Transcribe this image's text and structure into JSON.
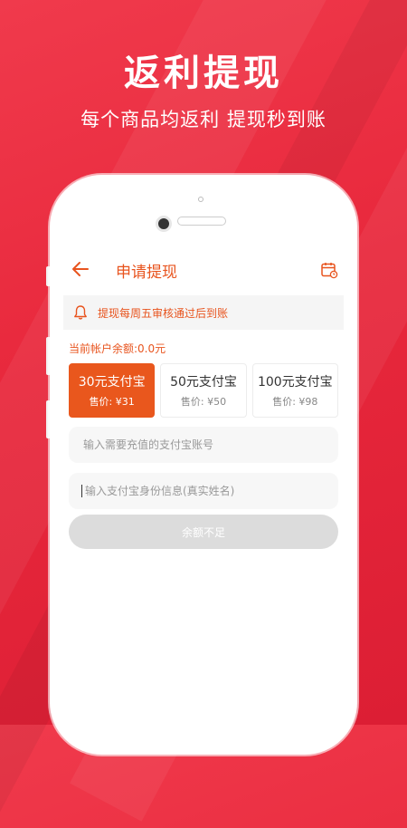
{
  "hero": {
    "title": "返利提现",
    "subtitle": "每个商品均返利  提现秒到账"
  },
  "app": {
    "nav_title": "申请提现",
    "notice": "提现每周五审核通过后到账",
    "balance": "当前帐户余额:0.0元",
    "options": [
      {
        "label": "30元支付宝",
        "price": "售价: ¥31",
        "selected": true
      },
      {
        "label": "50元支付宝",
        "price": "售价: ¥50",
        "selected": false
      },
      {
        "label": "100元支付宝",
        "price": "售价: ¥98",
        "selected": false
      }
    ],
    "account_placeholder": "输入需要充值的支付宝账号",
    "name_placeholder": "输入支付宝身份信息(真实姓名)",
    "submit_label": "余额不足"
  },
  "colors": {
    "accent": "#e9571d",
    "background": "#e8283c"
  },
  "icons": [
    "back-arrow-icon",
    "calendar-icon",
    "bell-icon"
  ]
}
